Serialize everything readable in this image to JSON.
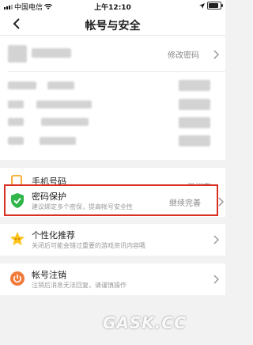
{
  "status_bar": {
    "carrier": "中国电信",
    "time": "上午12:10"
  },
  "nav": {
    "title": "帐号与安全"
  },
  "account": {
    "modify_password": "修改密码"
  },
  "items": [
    {
      "label": "手机号码",
      "value": "已绑定"
    },
    {
      "label": "密码保护",
      "sub": "建议绑定多个密保，提高帐号安全性",
      "value": "继续完善"
    },
    {
      "label": "个性化推荐",
      "sub": "关闭后可能会错过重要的游戏资讯内容哦"
    },
    {
      "label": "帐号注销",
      "sub": "注销后消息无法回复，请谨慎操作"
    }
  ],
  "watermark": "GASK.CC",
  "colors": {
    "accent": "#f5a623",
    "shield": "#2fb54a",
    "highlight": "#d93026",
    "cancel": "#f07a3a",
    "star": "#ffc21a"
  }
}
